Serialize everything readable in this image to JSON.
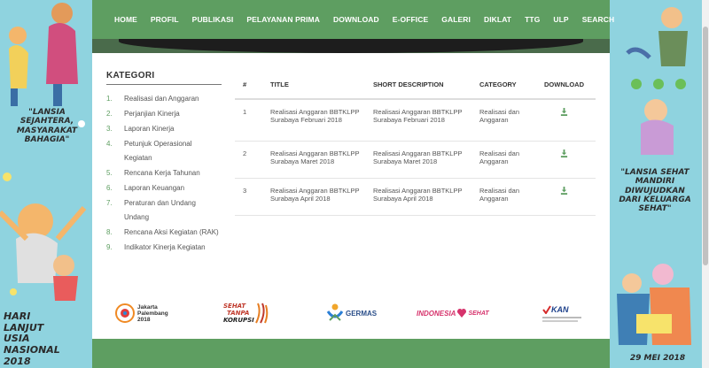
{
  "nav": {
    "items": [
      "HOME",
      "PROFIL",
      "PUBLIKASI",
      "PELAYANAN PRIMA",
      "DOWNLOAD",
      "E-OFFICE",
      "GALERI",
      "DIKLAT",
      "TTG",
      "ULP",
      "SEARCH"
    ]
  },
  "sidebar": {
    "title": "KATEGORI",
    "items": [
      {
        "num": "1.",
        "label": "Realisasi dan Anggaran"
      },
      {
        "num": "2.",
        "label": "Perjanjian Kinerja"
      },
      {
        "num": "3.",
        "label": "Laporan Kinerja"
      },
      {
        "num": "4.",
        "label": "Petunjuk Operasional Kegiatan"
      },
      {
        "num": "5.",
        "label": "Rencana Kerja Tahunan"
      },
      {
        "num": "6.",
        "label": "Laporan Keuangan"
      },
      {
        "num": "7.",
        "label": "Peraturan dan Undang Undang"
      },
      {
        "num": "8.",
        "label": "Rencana Aksi Kegiatan (RAK)"
      },
      {
        "num": "9.",
        "label": "Indikator Kinerja Kegiatan"
      }
    ]
  },
  "table": {
    "headers": {
      "num": "#",
      "title": "TITLE",
      "desc": "SHORT DESCRIPTION",
      "cat": "CATEGORY",
      "dl": "DOWNLOAD"
    },
    "rows": [
      {
        "num": "1",
        "title": "Realisasi Anggaran BBTKLPP Surabaya Februari 2018",
        "desc": "Realisasi Anggaran BBTKLPP Surabaya Februari 2018",
        "cat": "Realisasi dan Anggaran"
      },
      {
        "num": "2",
        "title": "Realisasi Anggaran BBTKLPP Surabaya Maret 2018",
        "desc": "Realisasi Anggaran BBTKLPP Surabaya Maret 2018",
        "cat": "Realisasi dan Anggaran"
      },
      {
        "num": "3",
        "title": "Realisasi Anggaran BBTKLPP Surabaya April 2018",
        "desc": "Realisasi Anggaran BBTKLPP Surabaya April 2018",
        "cat": "Realisasi dan Anggaran"
      }
    ]
  },
  "banners": {
    "left_top": "\"LANSIA SEJAHTERA, MASYARAKAT BAHAGIA\"",
    "left_bottom": "HARI LANJUT USIA NASIONAL 2018",
    "right_top": "\"LANSIA SEHAT MANDIRI DIWUJUDKAN DARI KELUARGA SEHAT\"",
    "right_bottom": "29 MEI 2018"
  },
  "logos": {
    "asian_games_line1": "Jakarta",
    "asian_games_line2": "Palembang",
    "asian_games_year": "2018",
    "sehat_line1": "SEHAT",
    "sehat_line2": "TANPA",
    "sehat_line3": "KORUPSI",
    "germas": "GERMAS",
    "indonesia_sehat_1": "INDONESIA",
    "indonesia_sehat_2": "SEHAT",
    "kan": "KAN"
  },
  "colors": {
    "nav_green": "#5e9e61",
    "accent_green": "#5e9e61",
    "banner_bg": "#8fd3df"
  },
  "icons": {
    "download": "download-icon"
  }
}
